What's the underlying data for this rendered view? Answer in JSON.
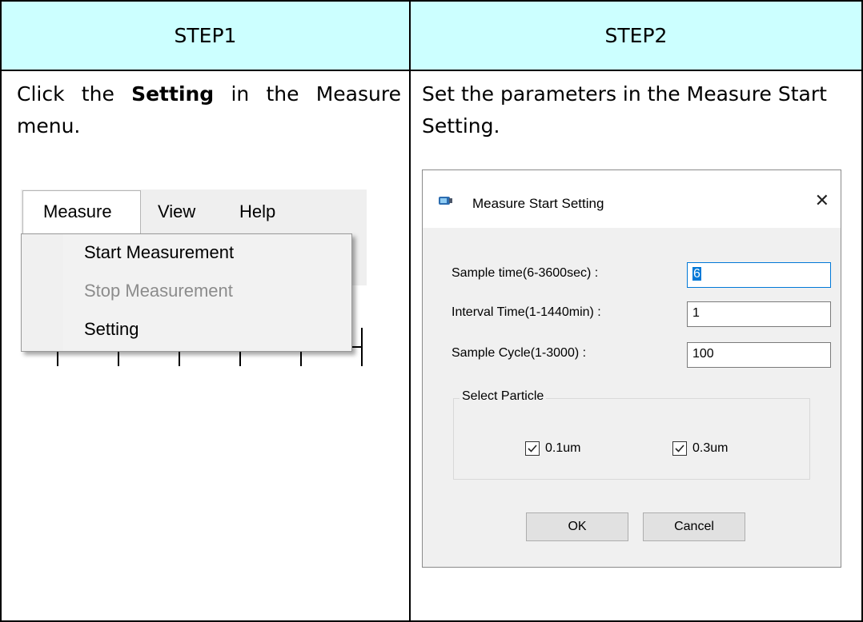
{
  "headers": {
    "step1": "STEP1",
    "step2": "STEP2"
  },
  "step1": {
    "desc_pre": "Click the ",
    "desc_bold": "Setting",
    "desc_post": " in the Measure menu.",
    "menubar": {
      "measure": "Measure",
      "view": "View",
      "help": "Help"
    },
    "dropdown": {
      "start": "Start Measurement",
      "stop": "Stop Measurement",
      "setting": "Setting"
    }
  },
  "step2": {
    "desc": "Set the parameters in the Measure Start Setting.",
    "dialog": {
      "title": "Measure Start Setting",
      "sample_time_label": "Sample time(6-3600sec) :",
      "sample_time_value": "6",
      "interval_label": "Interval Time(1-1440min) :",
      "interval_value": "1",
      "cycle_label": "Sample Cycle(1-3000) :",
      "cycle_value": "100",
      "group_title": "Select Particle",
      "cb1_label": "0.1um",
      "cb2_label": "0.3um",
      "ok": "OK",
      "cancel": "Cancel"
    }
  },
  "colors": {
    "header_bg": "#ccffff",
    "focus_blue": "#0078d7",
    "disabled_text": "#8c8c8c"
  }
}
